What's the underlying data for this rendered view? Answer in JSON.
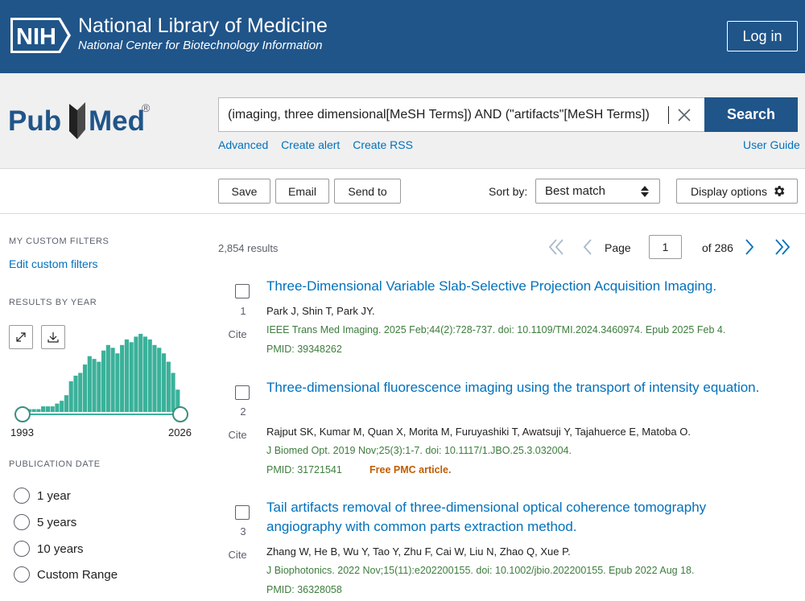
{
  "header": {
    "logo_text": "NIH",
    "title": "National Library of Medicine",
    "subtitle": "National Center for Biotechnology Information",
    "login_label": "Log in"
  },
  "search": {
    "logo_text": "PubMed",
    "query": "(imaging, three dimensional[MeSH Terms]) AND (\"artifacts\"[MeSH Terms])",
    "search_label": "Search",
    "links": [
      "Advanced",
      "Create alert",
      "Create RSS"
    ],
    "user_guide": "User Guide"
  },
  "actions": {
    "save": "Save",
    "email": "Email",
    "send_to": "Send to",
    "sort_label": "Sort by:",
    "sort_value": "Best match",
    "display_options": "Display options"
  },
  "sidebar": {
    "custom_filters_heading": "MY CUSTOM FILTERS",
    "edit_custom_filters": "Edit custom filters",
    "results_by_year_heading": "RESULTS BY YEAR",
    "year_start": "1993",
    "year_end": "2026",
    "publication_date_heading": "PUBLICATION DATE",
    "date_options": [
      "1 year",
      "5 years",
      "10 years",
      "Custom Range"
    ]
  },
  "results": {
    "count_text": "2,854 results",
    "page_label": "Page",
    "page_value": "1",
    "page_of": "of 286",
    "cite_label": "Cite",
    "articles": [
      {
        "number": "1",
        "title": "Three-Dimensional Variable Slab-Selective Projection Acquisition Imaging.",
        "authors": "Park J, Shin T, Park JY.",
        "journal": "IEEE Trans Med Imaging. 2025 Feb;44(2):728-737. doi: 10.1109/TMI.2024.3460974. Epub 2025 Feb 4.",
        "pmid": "PMID: 39348262",
        "free": ""
      },
      {
        "number": "2",
        "title": "Three-dimensional fluorescence imaging using the transport of intensity equation.",
        "authors": "Rajput SK, Kumar M, Quan X, Morita M, Furuyashiki T, Awatsuji Y, Tajahuerce E, Matoba O.",
        "journal": "J Biomed Opt. 2019 Nov;25(3):1-7. doi: 10.1117/1.JBO.25.3.032004.",
        "pmid": "PMID: 31721541",
        "free": "Free PMC article."
      },
      {
        "number": "3",
        "title": "Tail artifacts removal of three-dimensional optical coherence tomography angiography with common parts extraction method.",
        "authors": "Zhang W, He B, Wu Y, Tao Y, Zhu F, Cai W, Liu N, Zhao Q, Xue P.",
        "journal": "J Biophotonics. 2022 Nov;15(11):e202200155. doi: 10.1002/jbio.202200155. Epub 2022 Aug 18.",
        "pmid": "PMID: 36328058",
        "free": ""
      }
    ]
  },
  "chart_data": {
    "type": "bar",
    "x_range": [
      "1993",
      "2026"
    ],
    "values": [
      1,
      1,
      1,
      1,
      2,
      2,
      2,
      3,
      4,
      6,
      11,
      13,
      14,
      17,
      20,
      19,
      18,
      22,
      24,
      23,
      21,
      24,
      26,
      25,
      27,
      28,
      27,
      26,
      24,
      23,
      21,
      18,
      14,
      8
    ],
    "ylim": [
      0,
      30
    ],
    "color": "#3bb19a"
  },
  "colors": {
    "nih_blue": "#20558a",
    "link_blue": "#0071bc",
    "journal_green": "#3d7d3d",
    "free_orange": "#c05c00"
  }
}
